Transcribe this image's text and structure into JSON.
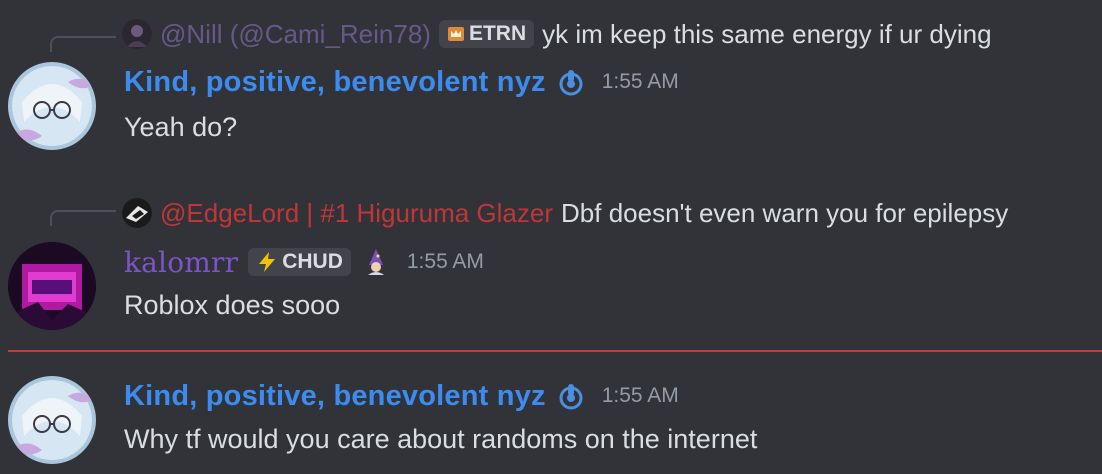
{
  "colors": {
    "background": "#313338",
    "username_blue": "#3c8cf0",
    "username_purple": "#7b55c7",
    "reply_nill": "#6a5b90",
    "reply_edgelord": "#c7373a",
    "new_divider": "#c9393c",
    "timestamp": "#949ba4"
  },
  "messages": [
    {
      "reply": {
        "author": "@Nill (@Cami_Rein78)",
        "tag_icon": "crown-shield-icon",
        "tag": "ETRN",
        "text": "yk im keep this same energy if ur dying"
      },
      "author": "Kind, positive, benevolent nyz",
      "badge_icon": "hand-emblem-icon",
      "time": "1:55 AM",
      "text": "Yeah do?"
    },
    {
      "reply": {
        "author": "@EdgeLord | #1 Higuruma Glazer",
        "text": "Dbf doesn't even warn you for epilepsy"
      },
      "author": "kalomrr",
      "tag_icon": "lightning-icon",
      "tag": "CHUD",
      "badge_icon": "wizard-icon",
      "time": "1:55 AM",
      "text": "Roblox does sooo"
    },
    {
      "author": "Kind, positive, benevolent nyz",
      "badge_icon": "hand-emblem-icon",
      "time": "1:55 AM",
      "text": "Why tf would you care about randoms on the internet"
    }
  ]
}
